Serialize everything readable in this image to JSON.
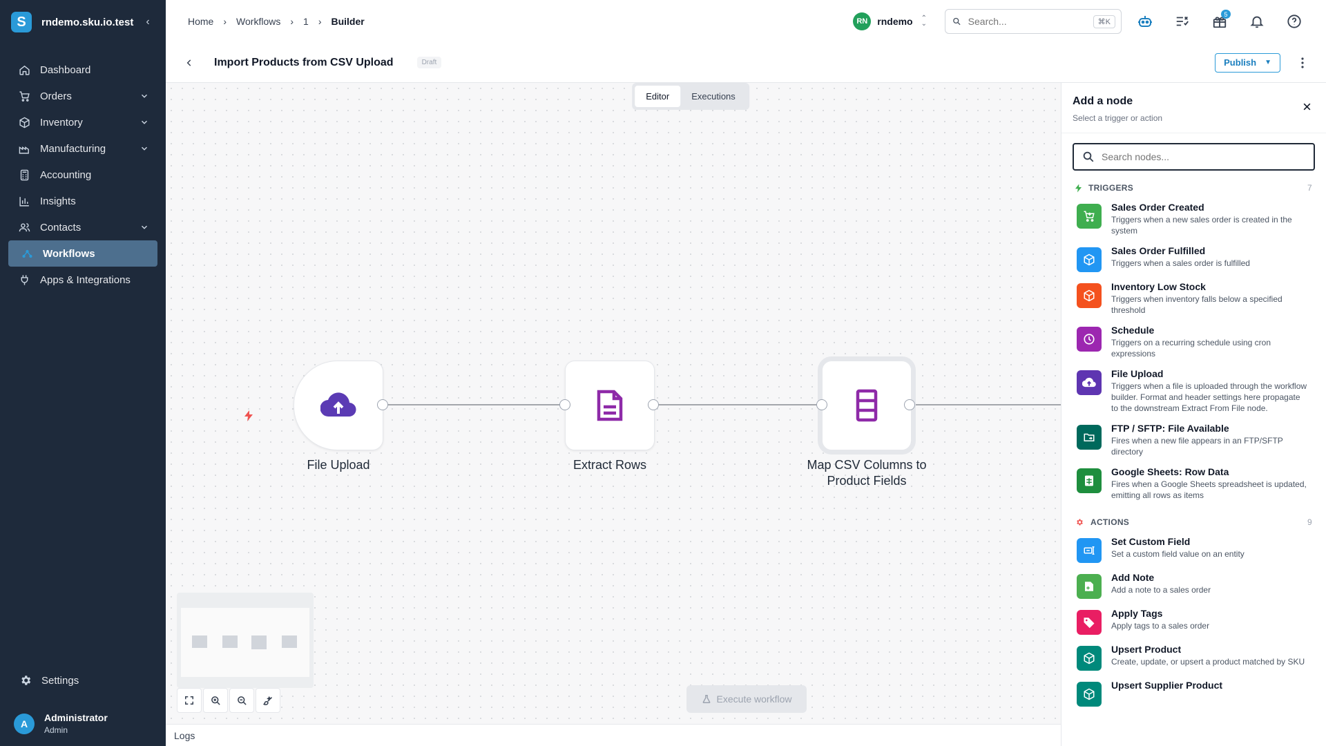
{
  "brand": {
    "name": "rndemo.sku.io.test",
    "logo_letter": "S"
  },
  "sidebar": {
    "items": [
      {
        "label": "Dashboard",
        "icon": "home-icon",
        "expandable": false,
        "active": false
      },
      {
        "label": "Orders",
        "icon": "cart-icon",
        "expandable": true,
        "active": false
      },
      {
        "label": "Inventory",
        "icon": "box-icon",
        "expandable": true,
        "active": false
      },
      {
        "label": "Manufacturing",
        "icon": "factory-icon",
        "expandable": true,
        "active": false
      },
      {
        "label": "Accounting",
        "icon": "calculator-icon",
        "expandable": false,
        "active": false
      },
      {
        "label": "Insights",
        "icon": "bar-chart-icon",
        "expandable": false,
        "active": false
      },
      {
        "label": "Contacts",
        "icon": "people-icon",
        "expandable": true,
        "active": false
      },
      {
        "label": "Workflows",
        "icon": "workflow-icon",
        "expandable": false,
        "active": true
      },
      {
        "label": "Apps & Integrations",
        "icon": "plug-icon",
        "expandable": false,
        "active": false
      }
    ],
    "settings_label": "Settings",
    "user": {
      "initial": "A",
      "name": "Administrator",
      "role": "Admin"
    }
  },
  "topbar": {
    "breadcrumbs": [
      "Home",
      "Workflows",
      "1",
      "Builder"
    ],
    "tenant": {
      "initials": "RN",
      "name": "rndemo"
    },
    "search": {
      "placeholder": "Search...",
      "shortcut": "⌘K"
    },
    "notification_count": "5"
  },
  "page": {
    "title": "Import Products from CSV Upload",
    "status": "Draft",
    "publish_label": "Publish"
  },
  "canvas": {
    "tabs": [
      {
        "label": "Editor",
        "active": true
      },
      {
        "label": "Executions",
        "active": false
      }
    ],
    "nodes": [
      {
        "label": "File Upload",
        "icon": "cloud-upload-icon",
        "color": "#5b3bb4"
      },
      {
        "label": "Extract Rows",
        "icon": "document-icon",
        "color": "#8e2aa8"
      },
      {
        "label": "Map CSV Columns to Product Fields",
        "icon": "columns-icon",
        "color": "#8e2aa8"
      }
    ],
    "execute_label": "Execute workflow",
    "logs_label": "Logs"
  },
  "panel": {
    "title": "Add a node",
    "subtitle": "Select a trigger or action",
    "search_placeholder": "Search nodes...",
    "triggers": {
      "label": "TRIGGERS",
      "count": "7",
      "items": [
        {
          "name": "Sales Order Created",
          "desc": "Triggers when a new sales order is created in the system",
          "color": "#3fae4f",
          "icon": "cart-add-icon"
        },
        {
          "name": "Sales Order Fulfilled",
          "desc": "Triggers when a sales order is fulfilled",
          "color": "#2196f3",
          "icon": "package-icon"
        },
        {
          "name": "Inventory Low Stock",
          "desc": "Triggers when inventory falls below a specified threshold",
          "color": "#f4511e",
          "icon": "package-alert-icon"
        },
        {
          "name": "Schedule",
          "desc": "Triggers on a recurring schedule using cron expressions",
          "color": "#9c27b0",
          "icon": "clock-icon"
        },
        {
          "name": "File Upload",
          "desc": "Triggers when a file is uploaded through the workflow builder. Format and header settings here propagate to the downstream Extract From File node.",
          "color": "#5e35b1",
          "icon": "cloud-upload-icon"
        },
        {
          "name": "FTP / SFTP: File Available",
          "desc": "Fires when a new file appears in an FTP/SFTP directory",
          "color": "#00695c",
          "icon": "folder-icon"
        },
        {
          "name": "Google Sheets: Row Data",
          "desc": "Fires when a Google Sheets spreadsheet is updated, emitting all rows as items",
          "color": "#1e8e3e",
          "icon": "sheet-icon"
        }
      ]
    },
    "actions": {
      "label": "ACTIONS",
      "count": "9",
      "items": [
        {
          "name": "Set Custom Field",
          "desc": "Set a custom field value on an entity",
          "color": "#2196f3",
          "icon": "field-icon"
        },
        {
          "name": "Add Note",
          "desc": "Add a note to a sales order",
          "color": "#4caf50",
          "icon": "note-icon"
        },
        {
          "name": "Apply Tags",
          "desc": "Apply tags to a sales order",
          "color": "#e91e63",
          "icon": "tag-icon"
        },
        {
          "name": "Upsert Product",
          "desc": "Create, update, or upsert a product matched by SKU",
          "color": "#00897b",
          "icon": "cube-icon"
        },
        {
          "name": "Upsert Supplier Product",
          "desc": "",
          "color": "#00897b",
          "icon": "cube-icon"
        }
      ]
    }
  }
}
